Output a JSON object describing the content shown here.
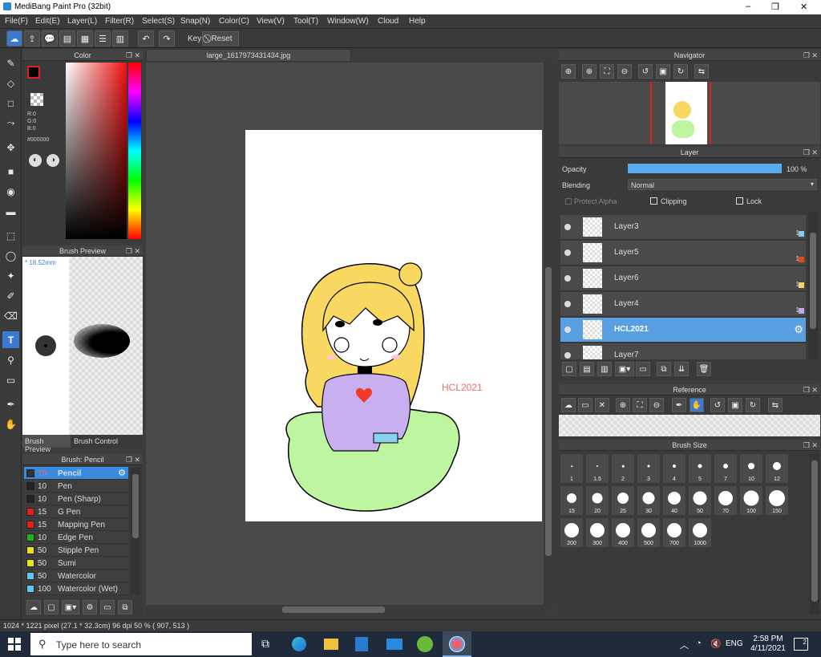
{
  "window": {
    "title": "MediBang Paint Pro (32bit)",
    "min": "–",
    "max": "❐",
    "close": "✕"
  },
  "menu": [
    "File(F)",
    "Edit(E)",
    "Layer(L)",
    "Filter(R)",
    "Select(S)",
    "Snap(N)",
    "Color(C)",
    "View(V)",
    "Tool(T)",
    "Window(W)",
    "Cloud",
    "Help"
  ],
  "toolbar": {
    "key_label": "Key",
    "reset_label": "Reset"
  },
  "color_panel": {
    "title": "Color",
    "r": "R:0",
    "g": "G:0",
    "b": "B:0",
    "hex": "#000000"
  },
  "brush_preview": {
    "title": "Brush Preview",
    "size": "* 18.52mm",
    "tab1": "Brush Preview",
    "tab2": "Brush Control"
  },
  "brush_list": {
    "title": "Brush: Pencil",
    "items": [
      {
        "size": "70",
        "name": "Pencil",
        "color": "#333333"
      },
      {
        "size": "10",
        "name": "Pen",
        "color": "#222222"
      },
      {
        "size": "10",
        "name": "Pen (Sharp)",
        "color": "#222222"
      },
      {
        "size": "15",
        "name": "G Pen",
        "color": "#e02020"
      },
      {
        "size": "15",
        "name": "Mapping Pen",
        "color": "#e02020"
      },
      {
        "size": "10",
        "name": "Edge Pen",
        "color": "#20b020"
      },
      {
        "size": "50",
        "name": "Stipple Pen",
        "color": "#e8e020"
      },
      {
        "size": "50",
        "name": "Sumi",
        "color": "#e8e020"
      },
      {
        "size": "50",
        "name": "Watercolor",
        "color": "#60c8f0"
      },
      {
        "size": "100",
        "name": "Watercolor (Wet)",
        "color": "#60c8f0"
      }
    ]
  },
  "document": {
    "tab": "large_1617973431434.jpg",
    "watermark": "HCL2021"
  },
  "status": {
    "text": "1024 * 1221 pixel  (27.1 * 32.3cm)  96 dpi  50 %  ( 907, 513 )"
  },
  "navigator": {
    "title": "Navigator"
  },
  "layer_panel": {
    "title": "Layer",
    "opacity_label": "Opacity",
    "opacity_value": "100 %",
    "opacity": 1.0,
    "blending_label": "Blending",
    "blending_value": "Normal",
    "protect_alpha": "Protect Alpha",
    "clipping": "Clipping",
    "lock": "Lock",
    "layers": [
      {
        "name": "Layer3",
        "swatch": "#7fd0f0",
        "one": "1"
      },
      {
        "name": "Layer5",
        "swatch": "#e04a20",
        "one": "1"
      },
      {
        "name": "Layer6",
        "swatch": "#f0d870",
        "one": "1"
      },
      {
        "name": "Layer4",
        "swatch": "#c0a8f0",
        "one": "1"
      },
      {
        "name": "HCL2021",
        "swatch": "",
        "one": ""
      },
      {
        "name": "Layer7",
        "swatch": "",
        "one": ""
      }
    ]
  },
  "reference": {
    "title": "Reference"
  },
  "brush_size": {
    "title": "Brush Size",
    "sizes": [
      "1",
      "1.5",
      "2",
      "3",
      "4",
      "5",
      "7",
      "10",
      "12",
      "15",
      "20",
      "25",
      "30",
      "40",
      "50",
      "70",
      "100",
      "150",
      "200",
      "300",
      "400",
      "500",
      "700",
      "1000"
    ]
  },
  "taskbar": {
    "search": "Type here to search",
    "time": "2:58 PM",
    "date": "4/11/2021",
    "lang": "ENG",
    "notif": "2"
  }
}
